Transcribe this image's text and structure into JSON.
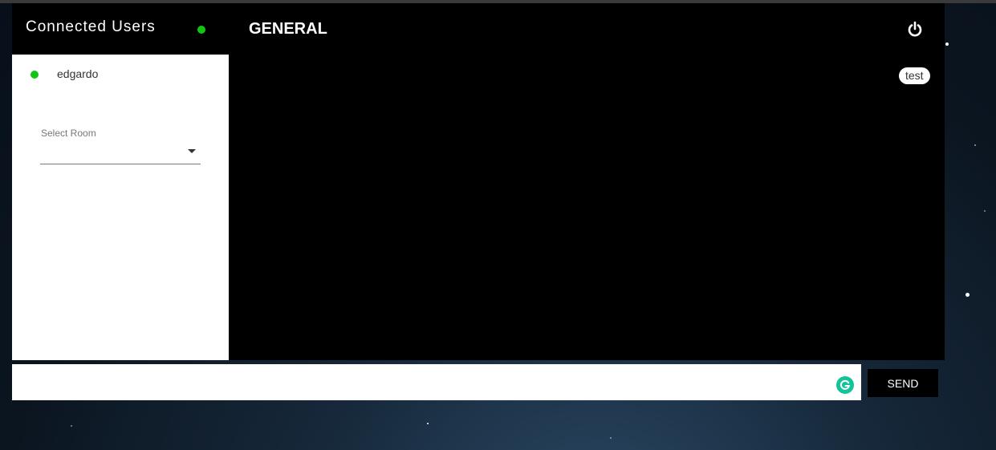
{
  "sidebar": {
    "title": "Connected Users",
    "users": [
      {
        "name": "edgardo",
        "status": "online"
      }
    ],
    "room_select": {
      "label": "Select Room",
      "selected": ""
    }
  },
  "chat": {
    "room_title": "GENERAL",
    "messages": [
      {
        "text": "test"
      }
    ]
  },
  "composer": {
    "input_value": "",
    "send_label": "SEND"
  },
  "icons": {
    "power": "power-icon",
    "grammarly": "grammarly-icon",
    "dropdown": "chevron-down-icon"
  },
  "colors": {
    "online": "#13c413",
    "panel_bg": "#000000",
    "grammarly": "#15c39a"
  }
}
